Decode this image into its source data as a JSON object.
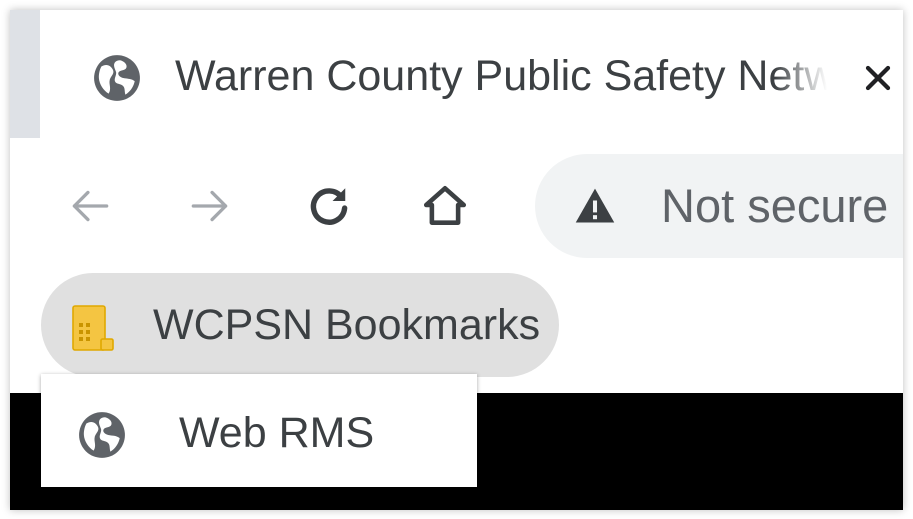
{
  "tab": {
    "title": "Warren County Public Safety Network",
    "icon": "globe-icon",
    "close_icon": "close-icon"
  },
  "toolbar": {
    "back_icon": "arrow-back-icon",
    "forward_icon": "arrow-forward-icon",
    "reload_icon": "reload-icon",
    "home_icon": "home-icon"
  },
  "omnibox": {
    "security_icon": "warning-triangle-icon",
    "security_text": "Not secure"
  },
  "bookmarks": {
    "folder_label": "WCPSN Bookmarks",
    "folder_icon": "folder-icon",
    "folder_icon_color": "#f4c542",
    "items": [
      {
        "label": "Web RMS",
        "icon": "globe-icon"
      }
    ]
  },
  "colors": {
    "tab_strip": "#dee1e6",
    "omnibox_bg": "#f1f3f4",
    "folder_chip_bg": "#e0e0e0",
    "text": "#3c4043",
    "icon_muted": "#a4a8ad",
    "content_bg": "#000000"
  }
}
